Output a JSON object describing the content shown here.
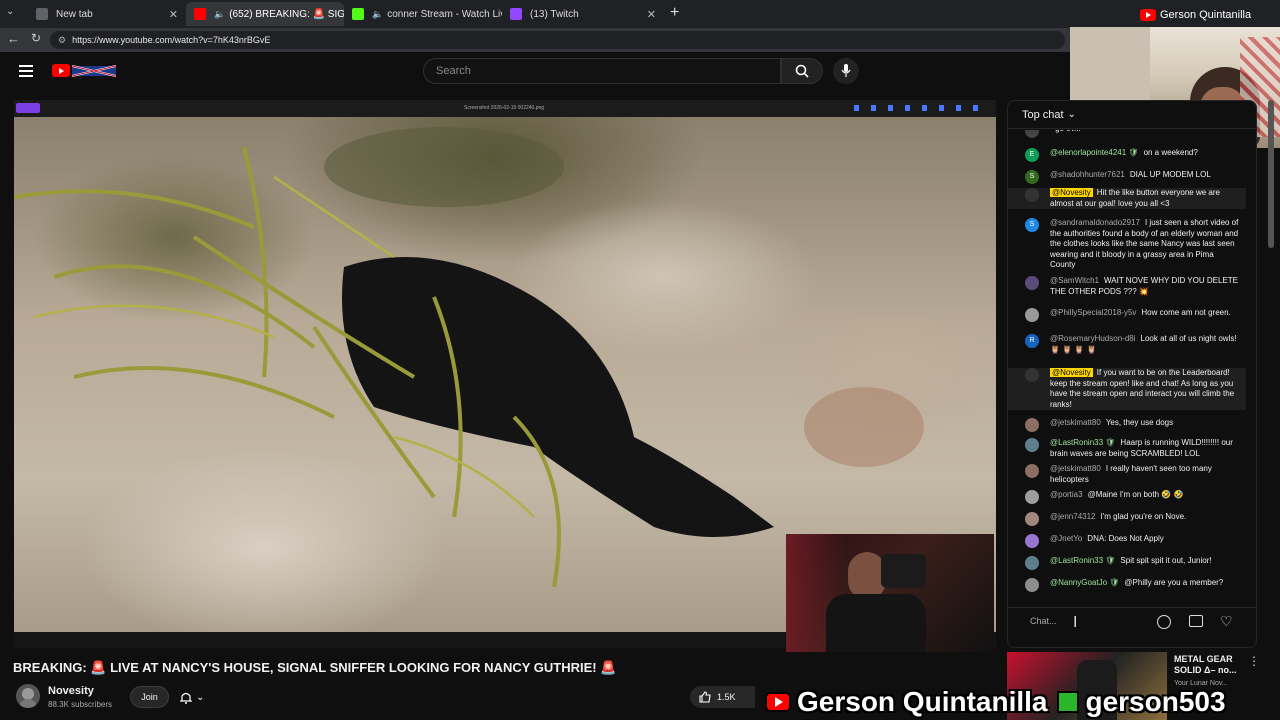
{
  "browser": {
    "tabs": [
      {
        "label": "New tab",
        "active": false
      },
      {
        "label": "(652) BREAKING: 🚨 SIGNAL",
        "active": true
      },
      {
        "label": "conner Stream - Watch Live o",
        "active": false
      },
      {
        "label": "(13) Twitch",
        "active": false
      }
    ],
    "new_tab_symbol": "+",
    "url": "https://www.youtube.com/watch?v=7hK43nrBGvE"
  },
  "youtube": {
    "search_placeholder": "Search"
  },
  "video": {
    "viewer_filename": "Screenshot 2026-02-15 002240.png"
  },
  "info": {
    "title": "BREAKING: 🚨 LIVE AT NANCY'S HOUSE, SIGNAL SNIFFER LOOKING FOR NANCY GUTHRIE! 🚨",
    "channel": "Novesity",
    "subscribers": "88.3K subscribers",
    "join_label": "Join",
    "likes": "1.5K"
  },
  "chat": {
    "header": "Top chat",
    "input_placeholder": "Chat...",
    "messages": [
      {
        "initial": "",
        "author": "",
        "text": "go ov...",
        "color": "#444",
        "mod": false,
        "grey": false
      },
      {
        "initial": "E",
        "author": "@elenorlapointe4241 🛡",
        "text": "on a weekend?",
        "color": "#0f9d58",
        "mod": false,
        "grey": false
      },
      {
        "initial": "S",
        "author": "@shadohhunter7621",
        "text": "DIAL UP MODEM LOL",
        "color": "#33691e",
        "mod": false,
        "grey": true
      },
      {
        "initial": "",
        "author": "@Novesity",
        "text": "Hit the like button everyone we are almost at our goal! love you all <3",
        "color": "#333",
        "mod": true,
        "grey": false
      },
      {
        "initial": "S",
        "author": "@sandramaldonado2917",
        "text": "I just seen a short video of the authorities found a body of an elderly woman and the clothes looks like the same Nancy was last seen wearing and it bloody in a grassy area in Pima County",
        "color": "#1e88e5",
        "mod": false,
        "grey": true
      },
      {
        "initial": "",
        "author": "@SamWitch1",
        "text": "WAIT NOVE WHY DID YOU DELETE THE OTHER PODS ??? 💥",
        "color": "#5a4c7a",
        "mod": false,
        "grey": true
      },
      {
        "initial": "",
        "author": "@PhillySpecial2018-y5v",
        "text": "How come am not green.",
        "color": "#999",
        "mod": false,
        "grey": true
      },
      {
        "initial": "R",
        "author": "@RosemaryHudson-d8i",
        "text": "Look at all of us night owls! 🦉 🦉 🦉 🦉",
        "color": "#1565c0",
        "mod": false,
        "grey": true
      },
      {
        "initial": "",
        "author": "@Novesity",
        "text": "If you want to be on the Leaderboard! keep the stream open! like and chat! As long as you have the stream open and interact you will climb the ranks!",
        "color": "#333",
        "mod": true,
        "grey": false
      },
      {
        "initial": "",
        "author": "@jetskimatt80",
        "text": "Yes, they use dogs",
        "color": "#8d6e63",
        "mod": false,
        "grey": true
      },
      {
        "initial": "",
        "author": "@LastRonin33 🛡",
        "text": "Haarp is running WILD!!!!!!!! our brain waves are being SCRAMBLED! LOL",
        "color": "#607d8b",
        "mod": false,
        "grey": false
      },
      {
        "initial": "",
        "author": "@jetskimatt80",
        "text": "I really haven't seen too many helicopters",
        "color": "#8d6e63",
        "mod": false,
        "grey": true
      },
      {
        "initial": "",
        "author": "@portia3",
        "text": "@Maine I'm on both 🤣 🤣",
        "color": "#9e9e9e",
        "mod": false,
        "grey": true
      },
      {
        "initial": "",
        "author": "@jenn74312",
        "text": "I'm glad you're on Nove.",
        "color": "#a1887f",
        "mod": false,
        "grey": true
      },
      {
        "initial": "",
        "author": "@JnetYo",
        "text": "DNA: Does Not Apply",
        "color": "#9575cd",
        "mod": false,
        "grey": true
      },
      {
        "initial": "",
        "author": "@LastRonin33 🛡",
        "text": "Spit spit spit it out, Junior!",
        "color": "#607d8b",
        "mod": false,
        "grey": false
      },
      {
        "initial": "",
        "author": "@NannyGoatJo 🛡",
        "text": "@Philly are you a member?",
        "color": "#8d8d8d",
        "mod": false,
        "grey": false
      }
    ]
  },
  "recommended": {
    "title": "METAL GEAR SOLID Δ– no...",
    "meta": "Your Lunar Nov..."
  },
  "overlay": {
    "top_name": "Gerson Quintanilla",
    "youtube_name": "Gerson Quintanilla",
    "twitch_name": "gerson503"
  },
  "colors": {
    "yt_red": "#ff0000",
    "chat_author_green": "#9fe59f",
    "mod_badge": "#ffd600",
    "twitch_green": "#2bb52b"
  },
  "icons": [
    "menu-icon",
    "search-icon",
    "mic-icon",
    "bell-icon",
    "chevron-down-icon",
    "thumbs-up-icon",
    "emoji-icon",
    "gift-icon",
    "heart-icon",
    "more-icon",
    "back-icon",
    "reload-icon"
  ]
}
